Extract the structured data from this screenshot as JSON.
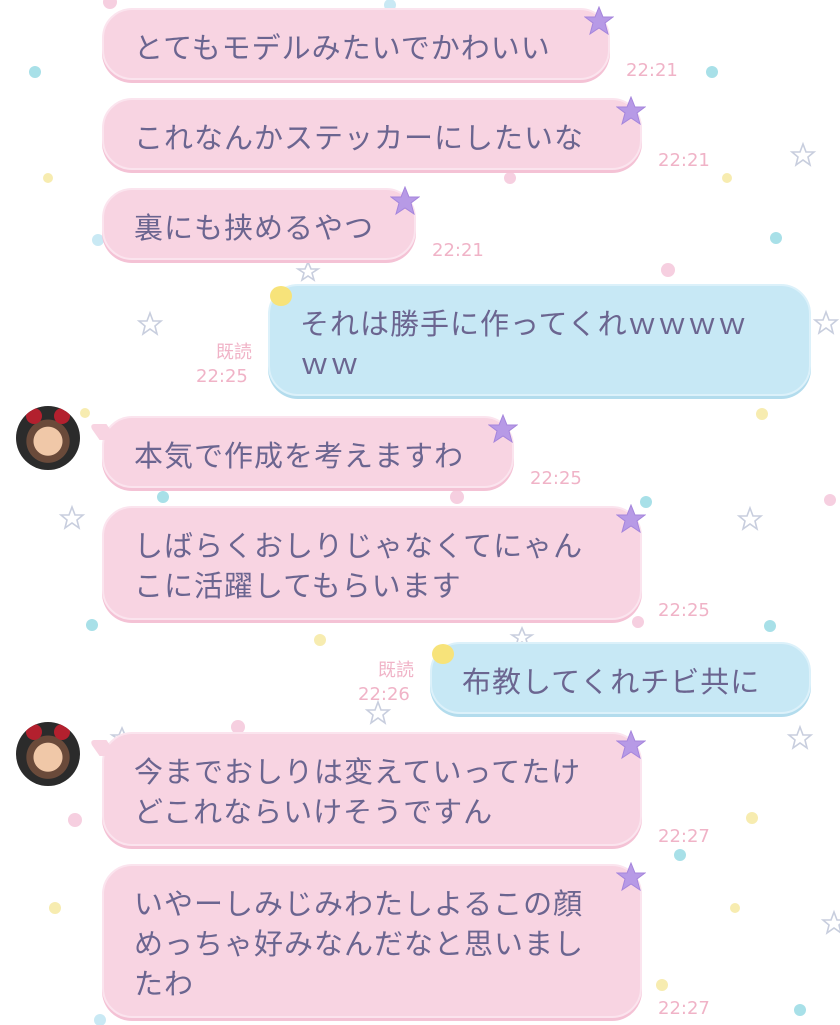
{
  "messages": [
    {
      "side": "in",
      "text": "とてもモデルみたいでかわいい",
      "time": "22:21",
      "avatar": false
    },
    {
      "side": "in",
      "text": "これなんかステッカーにしたいな",
      "time": "22:21",
      "avatar": false
    },
    {
      "side": "in",
      "text": "裏にも挟めるやつ",
      "time": "22:21",
      "avatar": false
    },
    {
      "side": "out",
      "text": "それは勝手に作ってくれｗｗｗｗ\nｗｗ",
      "time": "22:25",
      "read": "既読"
    },
    {
      "side": "in",
      "text": "本気で作成を考えますわ",
      "time": "22:25",
      "avatar": true
    },
    {
      "side": "in",
      "text": "しばらくおしりじゃなくてにゃん\nこに活躍してもらいます",
      "time": "22:25",
      "avatar": false
    },
    {
      "side": "out",
      "text": "布教してくれチビ共に",
      "time": "22:26",
      "read": "既読"
    },
    {
      "side": "in",
      "text": "今までおしりは変えていってたけ\nどこれならいけそうですん",
      "time": "22:27",
      "avatar": true
    },
    {
      "side": "in",
      "text": "いやーしみじみわたしよるこの顔\nめっちゃ好みなんだなと思いまし\nたわ",
      "time": "22:27",
      "avatar": false
    }
  ],
  "colors": {
    "incoming_bubble": "#f8d4e2",
    "outgoing_bubble": "#c7e8f5",
    "text": "#6b6590",
    "timestamp": "#f0b3c7",
    "star": "#b79ae6"
  },
  "icons": {
    "incoming_decoration": "purple-star-icon",
    "outgoing_decoration": "yellow-dot-icon",
    "avatar": "user-avatar"
  }
}
